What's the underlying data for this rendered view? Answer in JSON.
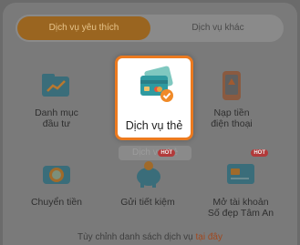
{
  "tabs": {
    "favorites": "Dịch vụ yêu thích",
    "other": "Dịch vụ khác"
  },
  "tiles": {
    "investment": "Danh mục\nđầu tư",
    "card_service": "Dịch vụ thẻ",
    "topup": "Nạp tiền\nđiện thoại",
    "transfer": "Chuyển tiền",
    "savings": "Gửi tiết kiệm",
    "open_account": "Mở tài khoản\nSố đẹp Tâm An"
  },
  "badges": {
    "hot1": "HOT",
    "hot2": "HOT"
  },
  "ghost_label": "Dịch vụ thẻ",
  "footer": {
    "text": "Tùy chỉnh danh sách dịch vụ ",
    "link": "tại đây"
  }
}
